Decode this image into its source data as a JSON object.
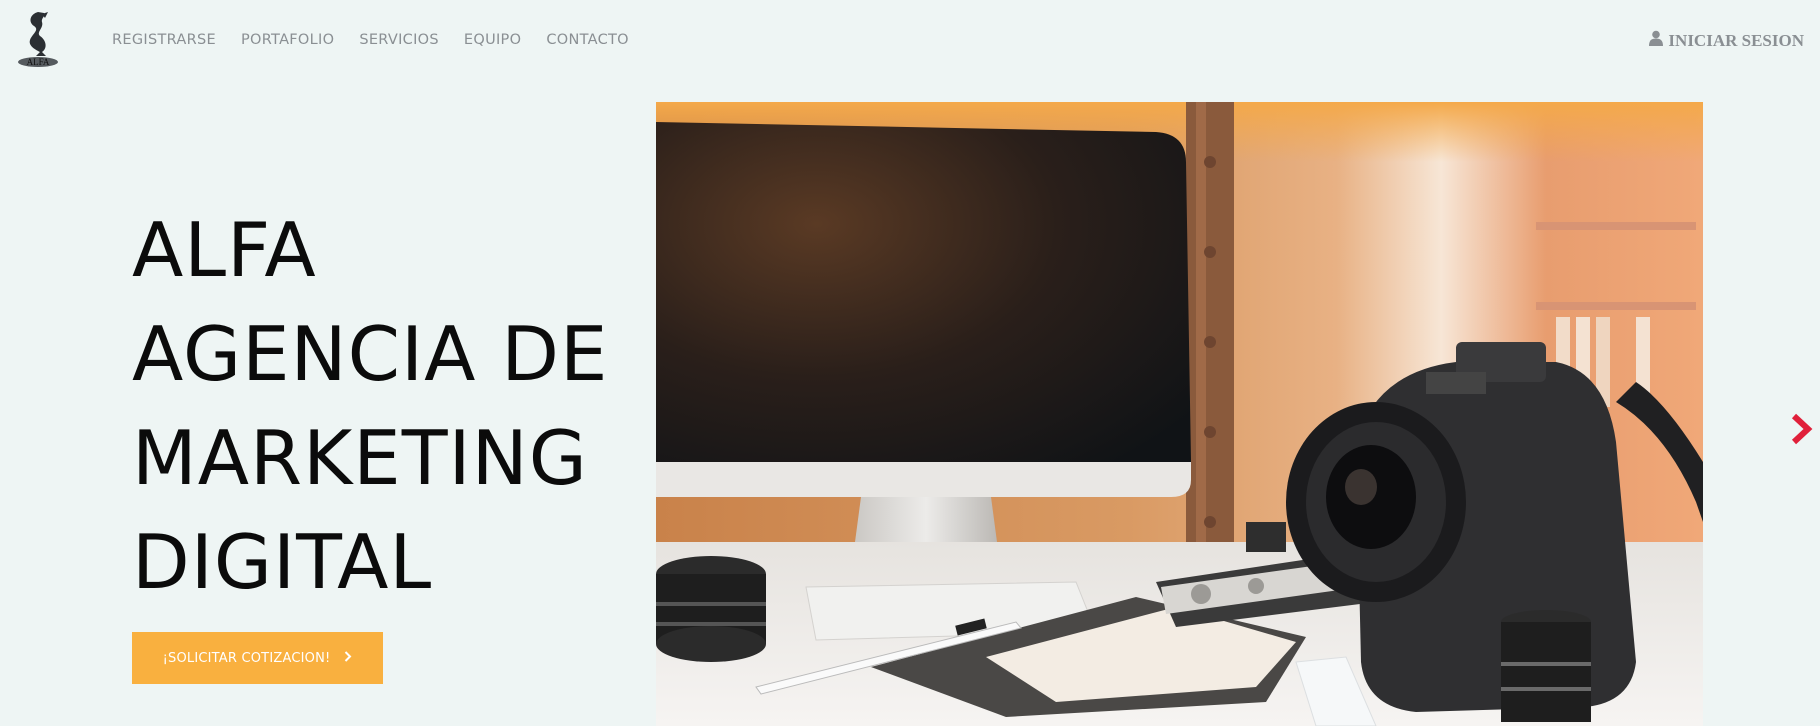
{
  "header": {
    "logo_text": "ALFA",
    "nav": [
      {
        "label": "REGISTRARSE"
      },
      {
        "label": "PORTAFOLIO"
      },
      {
        "label": "SERVICIOS"
      },
      {
        "label": "EQUIPO"
      },
      {
        "label": "CONTACTO"
      }
    ],
    "login_label": "INICIAR SESION",
    "login_icon": "user-icon"
  },
  "hero": {
    "title_lines": [
      "ALFA",
      "AGENCIA DE",
      "MARKETING",
      "DIGITAL"
    ],
    "cta_label": "¡SOLICITAR COTIZACION!",
    "cta_icon": "chevron-right-icon",
    "image_alt": "workspace-photo"
  },
  "slider": {
    "next_icon": "chevron-right-icon"
  },
  "colors": {
    "background": "#eef5f4",
    "nav_text": "#8a8f93",
    "cta_bg": "#f9b03f",
    "arrow": "#e0203a",
    "title": "#0b0b0b"
  }
}
